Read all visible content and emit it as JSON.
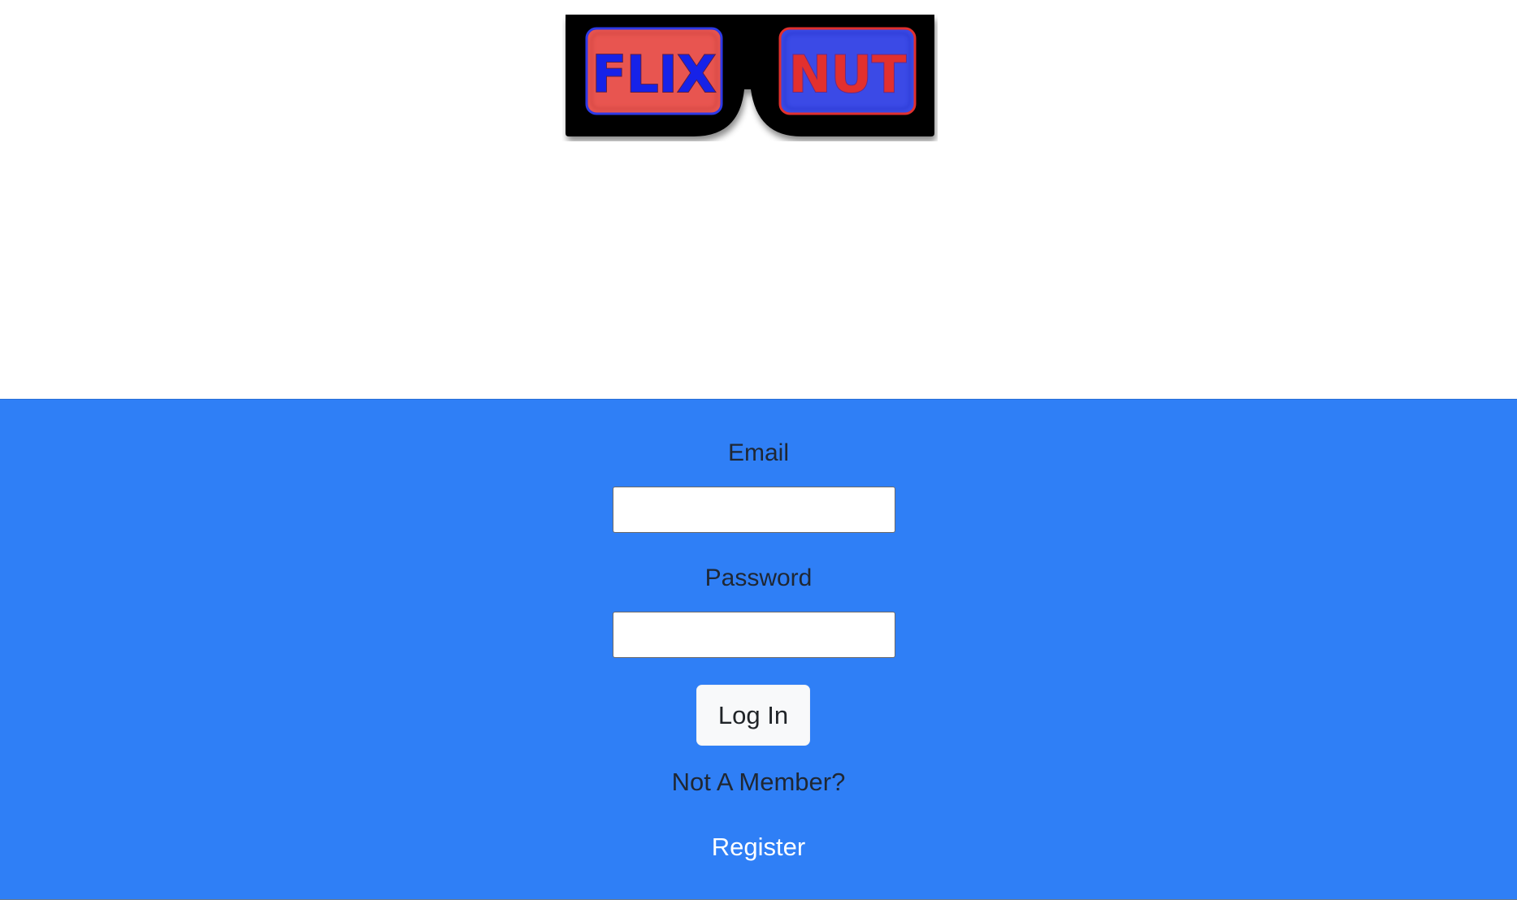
{
  "logo": {
    "left_lens_text": "FLIX",
    "right_lens_text": "NUT",
    "colors": {
      "frame": "#000000",
      "left_lens": "#e85550",
      "left_text": "#1622e8",
      "right_lens": "#3b4ae6",
      "right_text": "#e2302e"
    }
  },
  "login": {
    "background_color": "#2f7ff6",
    "email_label": "Email",
    "email_value": "",
    "password_label": "Password",
    "password_value": "",
    "login_button_label": "Log In",
    "not_member_text": "Not A Member?",
    "register_link_label": "Register"
  }
}
